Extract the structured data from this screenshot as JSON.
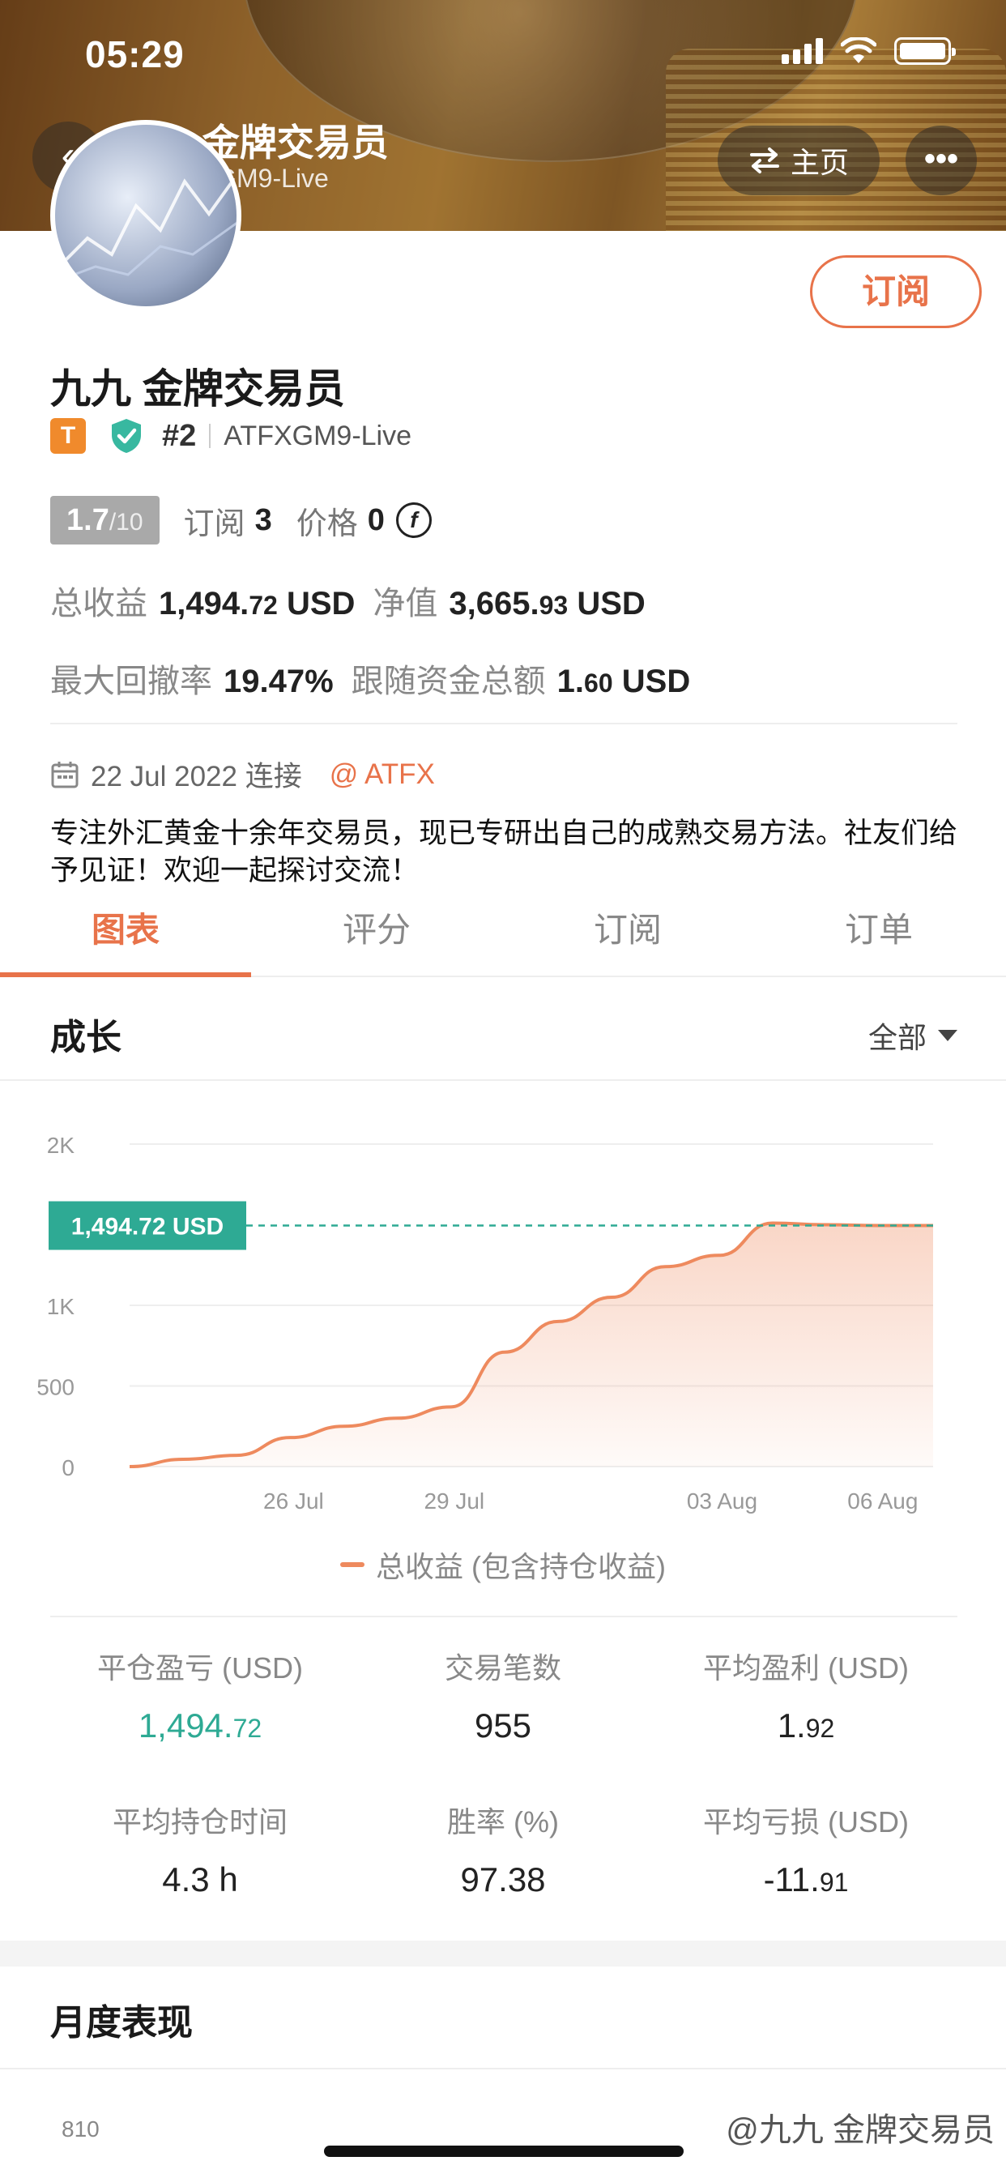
{
  "status_bar": {
    "time": "05:29"
  },
  "nav": {
    "title": "九九 金牌交易员",
    "subtitle": "#2 ATFXGM9-Live",
    "home_label": "主页",
    "more_label": "•••"
  },
  "profile": {
    "subscribe_label": "订阅",
    "name": "九九 金牌交易员",
    "badge_letter": "T",
    "rank": "#2",
    "account": "ATFXGM9-Live",
    "rating_value": "1.7",
    "rating_scale": "/10",
    "subscribe_count_label": "订阅",
    "subscribe_count": "3",
    "price_label": "价格",
    "price": "0",
    "total_profit_label": "总收益",
    "total_profit_main": "1,494.",
    "total_profit_dec": "72",
    "total_profit_unit": "USD",
    "equity_label": "净值",
    "equity_main": "3,665.",
    "equity_dec": "93",
    "equity_unit": "USD",
    "drawdown_label": "最大回撤率",
    "drawdown": "19.47%",
    "follow_funds_label": "跟随资金总额",
    "follow_funds_main": "1.",
    "follow_funds_dec": "60",
    "follow_funds_unit": "USD",
    "joined": "22 Jul 2022 连接",
    "broker": "@ ATFX",
    "bio": "专注外汇黄金十余年交易员，现已专研出自己的成熟交易方法。社友们给予见证！欢迎一起探讨交流！"
  },
  "tabs": [
    "图表",
    "评分",
    "订阅",
    "订单"
  ],
  "growth": {
    "title": "成长",
    "range": "全部",
    "current_label": "1,494.72 USD"
  },
  "chart_data": {
    "type": "area",
    "y_ticks": [
      "2K",
      "1K",
      "500",
      "0"
    ],
    "x_ticks": [
      "26 Jul",
      "29 Jul",
      "03 Aug",
      "06 Aug"
    ],
    "ylim": [
      0,
      2000
    ],
    "series": [
      {
        "name": "总收益 (包含持仓收益)",
        "color": "#ee8a5e",
        "x": [
          "23 Jul",
          "24 Jul",
          "25 Jul",
          "26 Jul",
          "27 Jul",
          "28 Jul",
          "29 Jul",
          "30 Jul",
          "31 Jul",
          "01 Aug",
          "02 Aug",
          "03 Aug",
          "04 Aug",
          "05 Aug",
          "06 Aug",
          "07 Aug"
        ],
        "values": [
          0,
          45,
          70,
          180,
          250,
          300,
          370,
          710,
          900,
          1050,
          1240,
          1310,
          1510,
          1500,
          1494.72,
          1494.72
        ]
      }
    ],
    "reference_value": 1494.72
  },
  "stats": [
    {
      "label": "平仓盈亏 (USD)",
      "main": "1,494.",
      "dec": "72",
      "highlight": true
    },
    {
      "label": "交易笔数",
      "main": "955",
      "dec": ""
    },
    {
      "label": "平均盈利 (USD)",
      "main": "1.",
      "dec": "92"
    },
    {
      "label": "平均持仓时间",
      "main": "4.3 h",
      "dec": ""
    },
    {
      "label": "胜率 (%)",
      "main": "97.38",
      "dec": ""
    },
    {
      "label": "平均亏损 (USD)",
      "main": "-11.",
      "dec": "91"
    }
  ],
  "monthly": {
    "title": "月度表现",
    "y_tick": "810"
  },
  "watermark": "@九九 金牌交易员",
  "colors": {
    "accent": "#e8734a",
    "green": "#2eaa94",
    "chart_line": "#ee8a5e",
    "label_bg": "#2eaa94"
  }
}
